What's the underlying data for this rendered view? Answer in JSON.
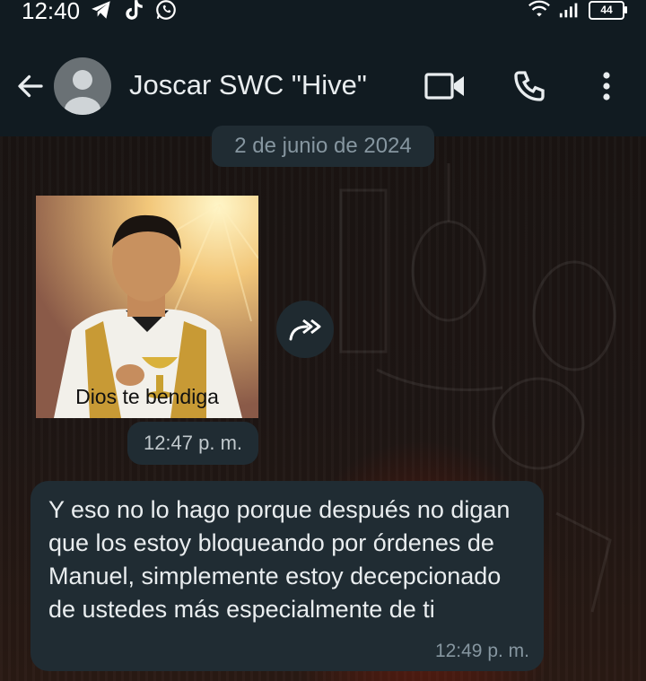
{
  "status_bar": {
    "time": "12:40",
    "left_icons": [
      "telegram-icon",
      "tiktok-icon",
      "whatsapp-icon"
    ],
    "right_icons": [
      "wifi-icon",
      "signal-icon"
    ],
    "battery": "44"
  },
  "header": {
    "contact_name": "Joscar SWC \"Hive\"",
    "icons": [
      "back-arrow-icon",
      "avatar-placeholder-icon",
      "video-call-icon",
      "voice-call-icon",
      "more-options-icon"
    ]
  },
  "chat": {
    "date_separator": "2 de junio de 2024",
    "image_message": {
      "caption": "Dios te bendiga",
      "time": "12:47 p. m."
    },
    "text_message": {
      "text": "Y eso no lo hago porque después no digan que los estoy bloqueando por órdenes de Manuel, simplemente estoy decepcionado de ustedes más especialmente de ti",
      "time": "12:49 p. m."
    }
  },
  "colors": {
    "header_bg": "#111b21",
    "bubble_bg": "#202c33",
    "text": "#e9edef",
    "meta_text": "#8696a0"
  }
}
